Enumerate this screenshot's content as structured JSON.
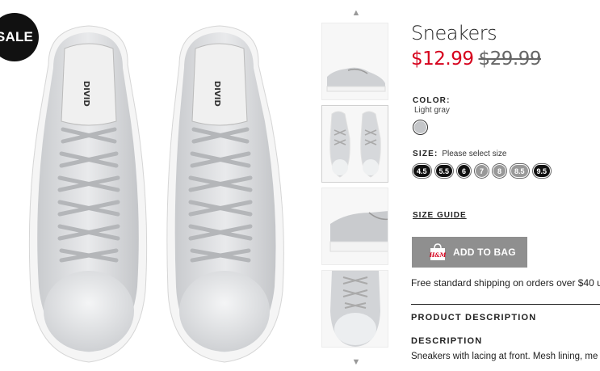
{
  "main_image": {
    "badge": "SALE"
  },
  "thumbnails": {
    "up_icon": "chevron-up-icon",
    "down_icon": "chevron-down-icon",
    "count": 4
  },
  "product": {
    "title": "Sneakers",
    "price_current": "$12.99",
    "price_original": "$29.99",
    "color_label": "COLOR:",
    "color_value": "Light gray",
    "swatch_color": "#c4c6c9",
    "size_label": "SIZE:",
    "size_hint": "Please select size",
    "sizes": [
      {
        "label": "4.5",
        "available": true
      },
      {
        "label": "5.5",
        "available": true
      },
      {
        "label": "6",
        "available": true
      },
      {
        "label": "7",
        "available": false
      },
      {
        "label": "8",
        "available": false
      },
      {
        "label": "8.5",
        "available": false
      },
      {
        "label": "9.5",
        "available": true
      }
    ],
    "size_guide": "SIZE GUIDE",
    "add_to_bag": "ADD TO BAG",
    "bag_icon": "shopping-bag-icon",
    "bag_logo": "H&M",
    "shipping": "Free standard shipping on orders over $40 u",
    "product_description_heading": "PRODUCT DESCRIPTION",
    "description_heading": "DESCRIPTION",
    "description_text": "Sneakers with lacing at front. Mesh lining, me"
  },
  "colors": {
    "sale_red": "#d6001c",
    "button_gray": "#8f8f8f",
    "badge_black": "#111111"
  }
}
